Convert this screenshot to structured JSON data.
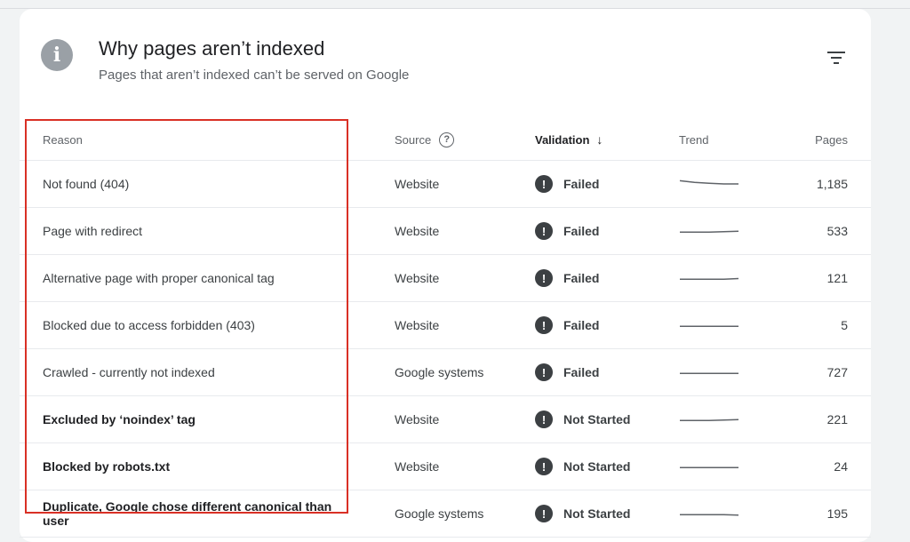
{
  "header": {
    "title": "Why pages aren’t indexed",
    "subtitle": "Pages that aren’t indexed can’t be served on Google"
  },
  "columns": {
    "reason": "Reason",
    "source": "Source",
    "validation": "Validation",
    "trend": "Trend",
    "pages": "Pages"
  },
  "rows": [
    {
      "reason": "Not found (404)",
      "source": "Website",
      "validation": "Failed",
      "pages": "1,185",
      "trend_values": [
        4,
        3.2,
        2.8,
        2.5,
        2.5
      ]
    },
    {
      "reason": "Page with redirect",
      "source": "Website",
      "validation": "Failed",
      "pages": "533",
      "trend_values": [
        2,
        2,
        2,
        2.2,
        2.4
      ]
    },
    {
      "reason": "Alternative page with proper canonical tag",
      "source": "Website",
      "validation": "Failed",
      "pages": "121",
      "trend_values": [
        2,
        2,
        2,
        2,
        2.3
      ]
    },
    {
      "reason": "Blocked due to access forbidden (403)",
      "source": "Website",
      "validation": "Failed",
      "pages": "5",
      "trend_values": [
        2,
        2,
        2,
        2,
        2
      ]
    },
    {
      "reason": "Crawled - currently not indexed",
      "source": "Google systems",
      "validation": "Failed",
      "pages": "727",
      "trend_values": [
        2,
        2,
        2,
        2,
        2
      ]
    },
    {
      "reason": "Excluded by ‘noindex’ tag",
      "source": "Website",
      "validation": "Not Started",
      "pages": "221",
      "trend_values": [
        2,
        2,
        2,
        2.2,
        2.4
      ]
    },
    {
      "reason": "Blocked by robots.txt",
      "source": "Website",
      "validation": "Not Started",
      "pages": "24",
      "trend_values": [
        2,
        2,
        2,
        2,
        2
      ]
    },
    {
      "reason": "Duplicate, Google chose different canonical than user",
      "source": "Google systems",
      "validation": "Not Started",
      "pages": "195",
      "trend_values": [
        2,
        2,
        2,
        2,
        1.8
      ]
    }
  ],
  "icons": {
    "header": "info-icon",
    "filter": "filter-icon",
    "source_help": "help-circle-icon",
    "sort": "arrow-down-icon",
    "status": "exclamation-circle-icon"
  },
  "colors": {
    "highlight": "#d93025",
    "status_icon": "#3c4043",
    "trend_line": "#5f6368"
  }
}
